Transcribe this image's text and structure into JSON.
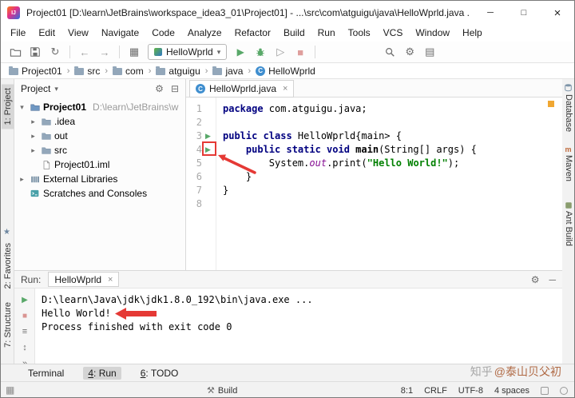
{
  "window": {
    "title": "Project01 [D:\\learn\\JetBrains\\workspace_idea3_01\\Project01] - ...\\src\\com\\atguigu\\java\\HelloWprld.java ...",
    "minimize": "─",
    "maximize": "□",
    "close": "×"
  },
  "menu": {
    "items": [
      "File",
      "Edit",
      "View",
      "Navigate",
      "Code",
      "Analyze",
      "Refactor",
      "Build",
      "Run",
      "Tools",
      "VCS",
      "Window",
      "Help"
    ]
  },
  "toolbar": {
    "run_config": "HelloWprld"
  },
  "breadcrumbs": {
    "items": [
      "Project01",
      "src",
      "com",
      "atguigu",
      "java",
      "HelloWprld"
    ]
  },
  "left_stripe": {
    "project": "1: Project",
    "favorites": "2: Favorites",
    "structure": "7: Structure"
  },
  "right_stripe": {
    "database": "Database",
    "maven": "Maven",
    "ant_build": "Ant Build"
  },
  "project_panel": {
    "header": "Project",
    "tree": [
      {
        "label": "Project01",
        "extra": "D:\\learn\\JetBrains\\w",
        "indent": 0,
        "icon": "folder-root",
        "arrow": "down",
        "bold": true
      },
      {
        "label": ".idea",
        "indent": 1,
        "icon": "folder",
        "arrow": "right"
      },
      {
        "label": "out",
        "indent": 1,
        "icon": "folder",
        "arrow": "right"
      },
      {
        "label": "src",
        "indent": 1,
        "icon": "folder",
        "arrow": "right"
      },
      {
        "label": "Project01.iml",
        "indent": 1,
        "icon": "file"
      },
      {
        "label": "External Libraries",
        "indent": 0,
        "icon": "library",
        "arrow": "right"
      },
      {
        "label": "Scratches and Consoles",
        "indent": 0,
        "icon": "scratch"
      }
    ]
  },
  "editor": {
    "tab": "HelloWprld.java",
    "lines": [
      [
        [
          "kw",
          "package"
        ],
        [
          "pl",
          " com.atguigu.java;"
        ]
      ],
      [],
      [
        [
          "kw",
          "public class"
        ],
        [
          "pl",
          " HelloWprld{main> {"
        ]
      ],
      [
        [
          "pl",
          "    "
        ],
        [
          "kw",
          "public static void"
        ],
        [
          "decl",
          " main"
        ],
        [
          "pl",
          "(String[] args) {"
        ]
      ],
      [
        [
          "pl",
          "        System."
        ],
        [
          "fld",
          "out"
        ],
        [
          "pl",
          ".print("
        ],
        [
          "str",
          "\"Hello World!\""
        ],
        [
          "pl",
          ");"
        ]
      ],
      [
        [
          "pl",
          "    }"
        ]
      ],
      [
        [
          "pl",
          "}"
        ]
      ],
      []
    ],
    "run_lines": [
      3,
      4
    ]
  },
  "run_panel": {
    "label": "Run:",
    "tab": "HelloWprld",
    "console": [
      "D:\\learn\\Java\\jdk\\jdk1.8.0_192\\bin\\java.exe ...",
      "Hello World!",
      "Process finished with exit code 0"
    ]
  },
  "bottom_bar": {
    "terminal": "Terminal",
    "run": {
      "mnemonic": "4",
      "rest": ": Run"
    },
    "todo": {
      "mnemonic": "6",
      "rest": ": TODO"
    }
  },
  "status_bar": {
    "build": "Build",
    "position": "8:1",
    "line_sep": "CRLF",
    "encoding": "UTF-8",
    "indent": "4 spaces"
  },
  "watermark": {
    "prefix": "知乎",
    "handle": "@泰山贝父初"
  },
  "colors": {
    "accent_blue": "#4083c9",
    "run_green": "#59a869",
    "error_red": "#e53935",
    "keyword_navy": "#000080",
    "string_green": "#008000",
    "field_purple": "#871094"
  },
  "icons": {
    "logo": "IJ",
    "sync": "↻",
    "back": "←",
    "forward": "→",
    "grid": "▦",
    "caret": "▾",
    "run": "▶",
    "coverage": "▷",
    "stop": "■",
    "gear": "⚙",
    "structure": "▤",
    "star": "★",
    "collapse": "⊟",
    "chev_right": "▸",
    "chev_down": "▾",
    "close": "×",
    "more": "»",
    "settings_eq": "≡",
    "updown": "↕",
    "hammer": "⚒",
    "switcher": "▦",
    "hide": "─",
    "maven_m": "m",
    "class_c": "C"
  }
}
